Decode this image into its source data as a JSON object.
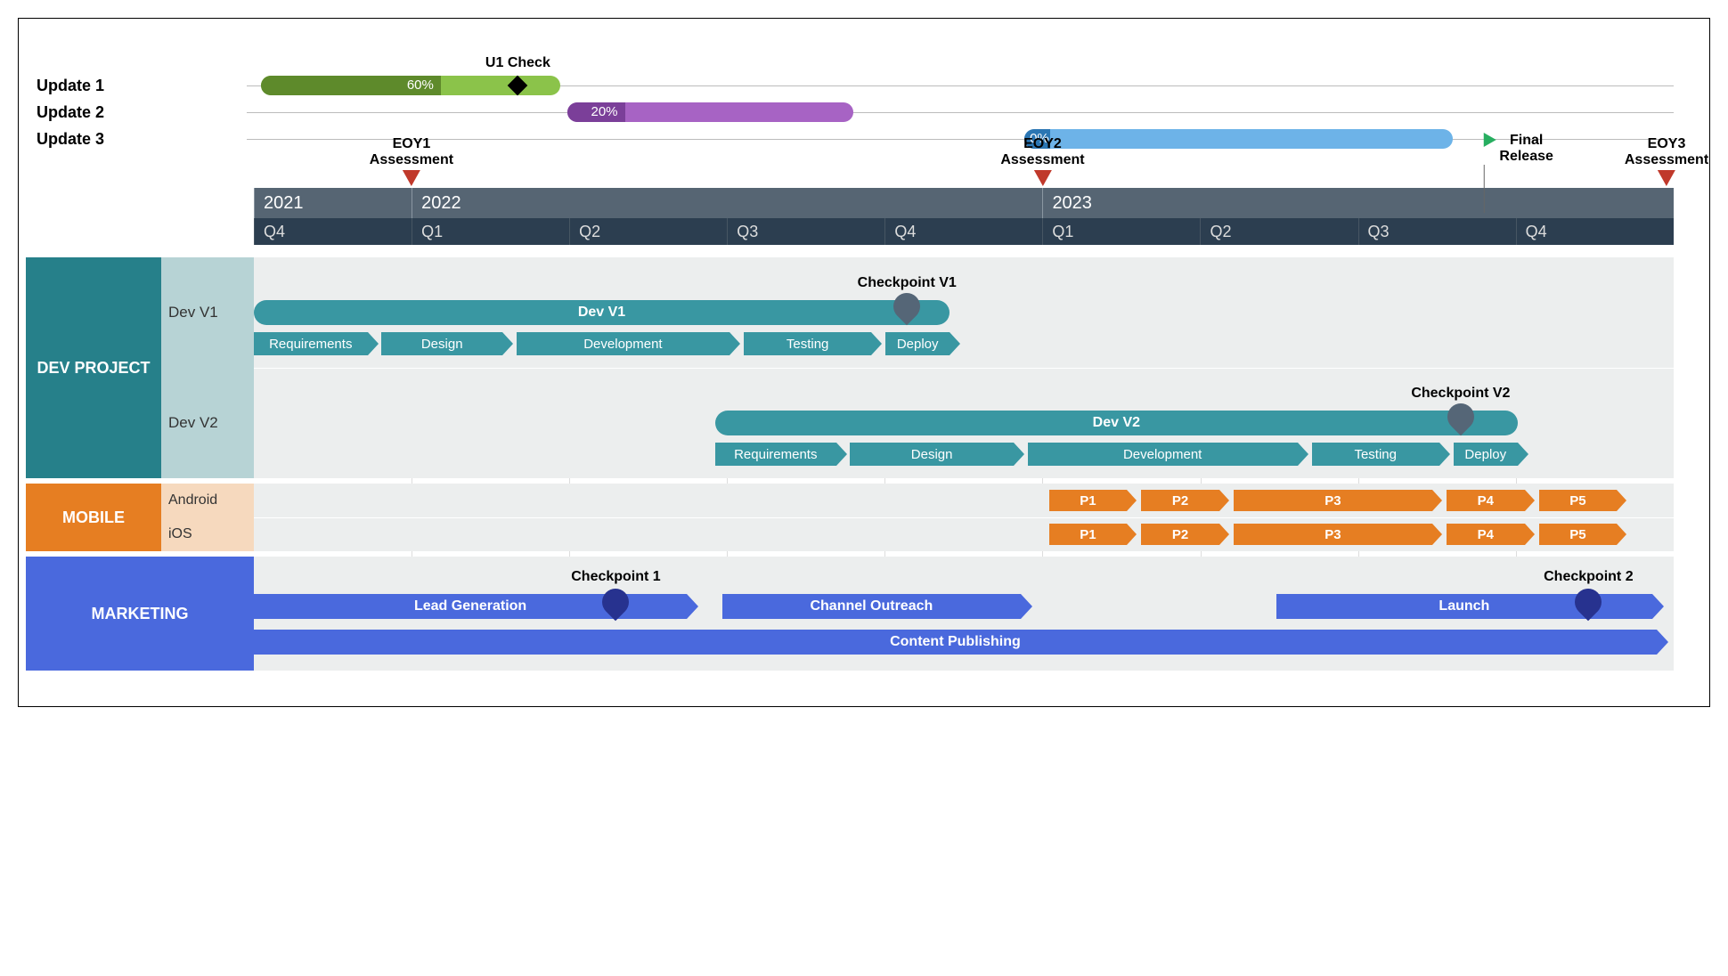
{
  "chart_data": {
    "type": "gantt",
    "timeline": {
      "start": "2021-Q4",
      "end": "2023-Q4",
      "years": [
        {
          "label": "2021",
          "quarters": [
            "Q4"
          ]
        },
        {
          "label": "2022",
          "quarters": [
            "Q1",
            "Q2",
            "Q3",
            "Q4"
          ]
        },
        {
          "label": "2023",
          "quarters": [
            "Q1",
            "Q2",
            "Q3",
            "Q4"
          ]
        }
      ],
      "markers": [
        {
          "label": "EOY1\nAssessment",
          "position": "2022-01-01",
          "type": "triangle-red"
        },
        {
          "label": "EOY2\nAssessment",
          "position": "2023-01-01",
          "type": "triangle-red"
        },
        {
          "label": "Final\nRelease",
          "position": "2023-Q3-end",
          "type": "flag-green"
        },
        {
          "label": "EOY3\nAssessment",
          "position": "2023-Q4-end",
          "type": "triangle-red"
        }
      ]
    },
    "updates": [
      {
        "name": "Update 1",
        "start_pct": 1,
        "width_pct": 21,
        "progress": 60,
        "color": "#5e8a2b",
        "light": "#8bc34a",
        "milestone": {
          "label": "U1 Check",
          "at_pct": 19
        }
      },
      {
        "name": "Update 2",
        "start_pct": 22.5,
        "width_pct": 20,
        "progress": 20,
        "color": "#7b3f99",
        "light": "#a763c4"
      },
      {
        "name": "Update 3",
        "start_pct": 54.5,
        "width_pct": 30,
        "progress": 0,
        "color": "#2b76b3",
        "light": "#6db3e8"
      }
    ],
    "sections": [
      {
        "name": "DEV PROJECT",
        "header_color": "#26808a",
        "groups": [
          {
            "name": "Dev V1",
            "summary": {
              "label": "Dev V1",
              "start_pct": 0,
              "width_pct": 49
            },
            "milestone": {
              "label": "Checkpoint V1",
              "at_pct": 46
            },
            "tasks": [
              {
                "label": "Requirements",
                "start_pct": 0,
                "width_pct": 8
              },
              {
                "label": "Design",
                "start_pct": 9,
                "width_pct": 8.5
              },
              {
                "label": "Development",
                "start_pct": 18.5,
                "width_pct": 15
              },
              {
                "label": "Testing",
                "start_pct": 34.5,
                "width_pct": 9
              },
              {
                "label": "Deploy",
                "start_pct": 44.5,
                "width_pct": 4.5
              }
            ]
          },
          {
            "name": "Dev V2",
            "summary": {
              "label": "Dev V2",
              "start_pct": 32.5,
              "width_pct": 56.5
            },
            "milestone": {
              "label": "Checkpoint V2",
              "at_pct": 85
            },
            "tasks": [
              {
                "label": "Requirements",
                "start_pct": 32.5,
                "width_pct": 8.5
              },
              {
                "label": "Design",
                "start_pct": 42,
                "width_pct": 11.5
              },
              {
                "label": "Development",
                "start_pct": 54.5,
                "width_pct": 19
              },
              {
                "label": "Testing",
                "start_pct": 74.5,
                "width_pct": 9
              },
              {
                "label": "Deploy",
                "start_pct": 84.5,
                "width_pct": 4.5
              }
            ]
          }
        ]
      },
      {
        "name": "MOBILE",
        "header_color": "#e67e22",
        "groups": [
          {
            "name": "Android",
            "tasks": [
              {
                "label": "P1",
                "start_pct": 56,
                "width_pct": 5.5
              },
              {
                "label": "P2",
                "start_pct": 62.5,
                "width_pct": 5.5
              },
              {
                "label": "P3",
                "start_pct": 69,
                "width_pct": 14
              },
              {
                "label": "P4",
                "start_pct": 84,
                "width_pct": 5.5
              },
              {
                "label": "P5",
                "start_pct": 90.5,
                "width_pct": 5.5
              }
            ]
          },
          {
            "name": "iOS",
            "tasks": [
              {
                "label": "P1",
                "start_pct": 56,
                "width_pct": 5.5
              },
              {
                "label": "P2",
                "start_pct": 62.5,
                "width_pct": 5.5
              },
              {
                "label": "P3",
                "start_pct": 69,
                "width_pct": 14
              },
              {
                "label": "P4",
                "start_pct": 84,
                "width_pct": 5.5
              },
              {
                "label": "P5",
                "start_pct": 90.5,
                "width_pct": 5.5
              }
            ]
          }
        ]
      },
      {
        "name": "MARKETING",
        "header_color": "#4a69dd",
        "tasks_row1": [
          {
            "label": "Lead Generation",
            "start_pct": 0,
            "width_pct": 30.5
          },
          {
            "label": "Channel Outreach",
            "start_pct": 33,
            "width_pct": 21
          },
          {
            "label": "Launch",
            "start_pct": 72,
            "width_pct": 26.5
          }
        ],
        "tasks_row2": [
          {
            "label": "Content Publishing",
            "start_pct": 0,
            "width_pct": 98.8
          }
        ],
        "milestones": [
          {
            "label": "Checkpoint 1",
            "at_pct": 25.5
          },
          {
            "label": "Checkpoint 2",
            "at_pct": 94
          }
        ]
      }
    ]
  }
}
